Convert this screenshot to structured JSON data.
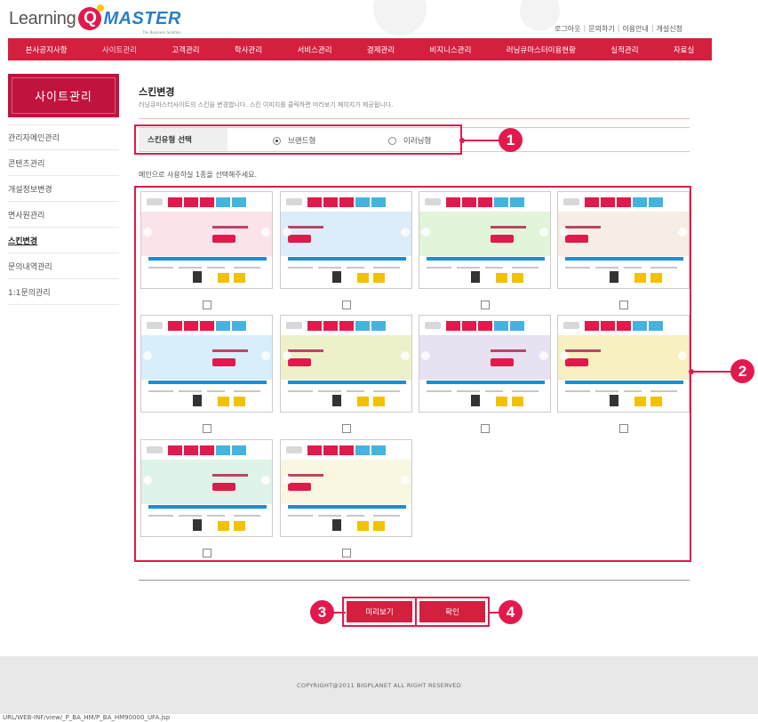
{
  "header": {
    "logo_part1": "Learning",
    "logo_q": "Q",
    "logo_part2": "MASTER",
    "logo_tagline": "The Business Solution",
    "util_links": [
      "로그아웃",
      "문의하기",
      "이용안내",
      "개설신청"
    ]
  },
  "gnb": {
    "items": [
      "본사공지사항",
      "사이트관리",
      "고객관리",
      "학사관리",
      "서비스관리",
      "결제관리",
      "비지니스관리",
      "러닝큐마스터이용현황",
      "실적관리",
      "자료실"
    ],
    "active_index": 1
  },
  "sidebar": {
    "title": "사이트관리",
    "items": [
      "관리자메인관리",
      "콘텐츠관리",
      "개설정보변경",
      "면사원관리",
      "스킨변경",
      "문의내역관리",
      "1:1문의관리"
    ],
    "active_index": 4
  },
  "main": {
    "title": "스킨변경",
    "description": "러닝큐마스터사이트의 스킨을 변경합니다. 스킨 이미지를 클릭하면 미리보기 페이지가 제공됩니다.",
    "skin_type_label": "스킨유형 선택",
    "radio_options": [
      {
        "label": "브랜드형",
        "checked": true
      },
      {
        "label": "이러닝형",
        "checked": false
      }
    ],
    "guide_text": "메인으로 사용하실 1종을 선택해주세요.",
    "thumbnail_count": 10,
    "thumbnails": [
      {
        "theme": "pink"
      },
      {
        "theme": "blue"
      },
      {
        "theme": "green"
      },
      {
        "theme": "beige"
      },
      {
        "theme": "sky"
      },
      {
        "theme": "olive"
      },
      {
        "theme": "lavender"
      },
      {
        "theme": "yellow"
      },
      {
        "theme": "mint"
      },
      {
        "theme": "cream"
      }
    ],
    "preview_button": "미리보기",
    "confirm_button": "확인"
  },
  "callouts": [
    "1",
    "2",
    "3",
    "4"
  ],
  "footer": {
    "copyright": "COPYRIGHT@2011 BIGPLANET ALL RIGHT RESERVED",
    "url": "URL/WEB-INF/view/_P_BA_HM/P_BA_HM90000_UFA.jsp"
  },
  "colors": {
    "brand_red": "#d3203e",
    "callout_red": "#e2194c",
    "accent_blue": "#2a7fc6",
    "theme_pink": "#fbe3ea",
    "theme_blue": "#dcecf8",
    "theme_green": "#e2f4da",
    "theme_beige": "#f6eee4",
    "theme_sky": "#d7eefb",
    "theme_olive": "#eef0c9",
    "theme_lavender": "#e8e1f1",
    "theme_yellow": "#f8f0c0",
    "theme_mint": "#dff3e8",
    "theme_cream": "#f9f6e2"
  }
}
